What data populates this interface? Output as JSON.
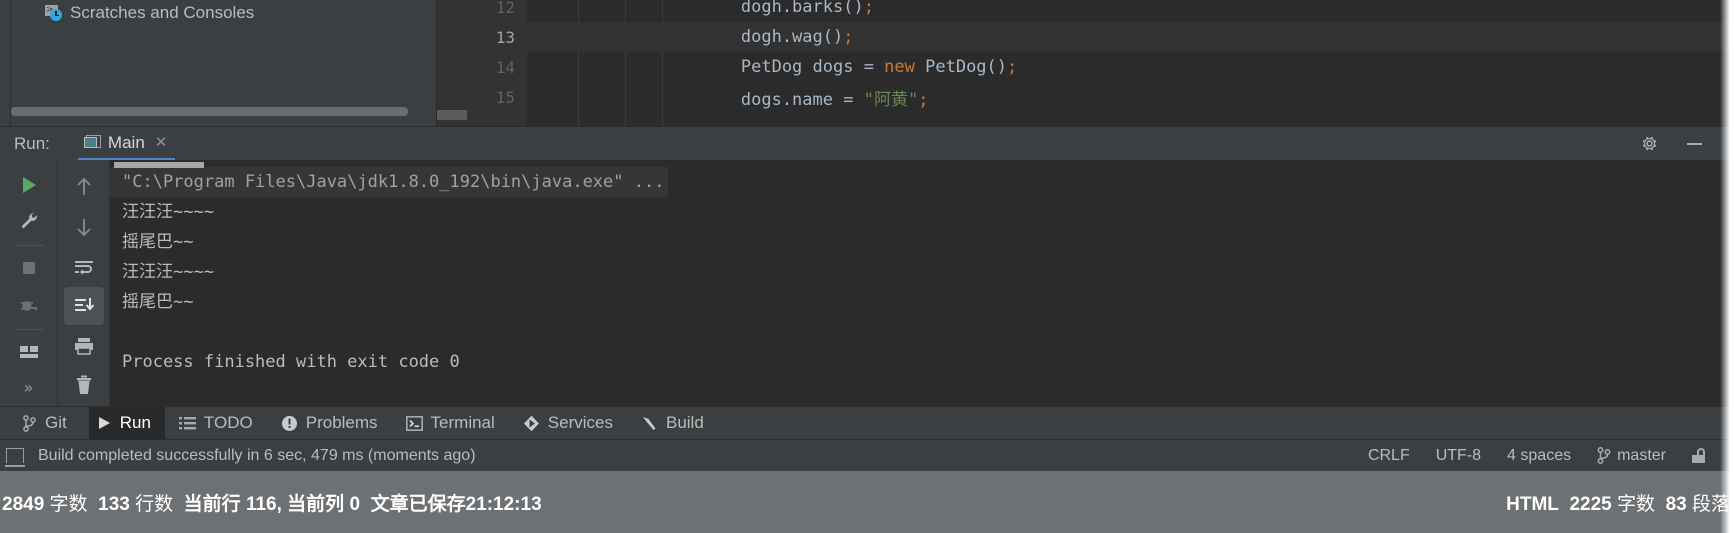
{
  "project_pane": {
    "tree_item": "Scratches and Consoles"
  },
  "editor": {
    "lines": [
      {
        "num": "12",
        "segments": [
          {
            "t": "        dogh.barks()",
            "c": "plain"
          },
          {
            "t": ";",
            "c": "punc"
          }
        ],
        "current": false
      },
      {
        "num": "13",
        "segments": [
          {
            "t": "        dogh.wag()",
            "c": "plain"
          },
          {
            "t": ";",
            "c": "punc"
          }
        ],
        "current": true
      },
      {
        "num": "14",
        "segments": [
          {
            "t": "        PetDog dogs = ",
            "c": "plain"
          },
          {
            "t": "new",
            "c": "kw"
          },
          {
            "t": " PetDog()",
            "c": "plain"
          },
          {
            "t": ";",
            "c": "punc"
          }
        ],
        "current": false
      },
      {
        "num": "15",
        "segments": [
          {
            "t": "        dogs.name = ",
            "c": "plain"
          },
          {
            "t": "\"阿黄\"",
            "c": "str"
          },
          {
            "t": ";",
            "c": "punc"
          }
        ],
        "current": false
      }
    ]
  },
  "run_panel": {
    "label": "Run:",
    "tab_name": "Main",
    "tab_close": "✕",
    "gear_icon": "gear-icon",
    "minimize_icon": "minimize-icon",
    "toolbar_left": [
      {
        "name": "rerun-button",
        "icon": "play-icon"
      },
      {
        "name": "edit-configurations-button",
        "icon": "wrench-icon"
      },
      {
        "name": "stop-button",
        "icon": "stop-square-icon"
      },
      {
        "name": "rerun-failed-tests-button",
        "icon": "bug-rerun-icon"
      },
      {
        "name": "layout-settings-button",
        "icon": "layout-icon"
      },
      {
        "name": "expand-toolbar-button",
        "icon": "double-chevron-right-icon",
        "glyph": "»"
      }
    ],
    "toolbar_right": [
      {
        "name": "up-the-stack-trace-button",
        "icon": "arrow-up-icon"
      },
      {
        "name": "down-the-stack-trace-button",
        "icon": "arrow-down-icon"
      },
      {
        "name": "soft-wrap-button",
        "icon": "soft-wrap-icon"
      },
      {
        "name": "scroll-to-end-button",
        "icon": "scroll-to-end-icon",
        "selected": true
      },
      {
        "name": "print-button",
        "icon": "printer-icon"
      },
      {
        "name": "clear-all-button",
        "icon": "trash-icon"
      }
    ],
    "console_lines": [
      {
        "text": "\"C:\\Program Files\\Java\\jdk1.8.0_192\\bin\\java.exe\" ...",
        "kind": "command"
      },
      {
        "text": "汪汪汪~~~~",
        "kind": "out"
      },
      {
        "text": "摇尾巴~~",
        "kind": "out"
      },
      {
        "text": "汪汪汪~~~~",
        "kind": "out"
      },
      {
        "text": "摇尾巴~~",
        "kind": "out"
      },
      {
        "text": "",
        "kind": "out"
      },
      {
        "text": "Process finished with exit code 0",
        "kind": "out"
      }
    ]
  },
  "bottom_tabs": [
    {
      "label": "Git",
      "icon": "git-branch-icon",
      "active": false
    },
    {
      "label": "Run",
      "icon": "play-icon",
      "active": true
    },
    {
      "label": "TODO",
      "icon": "list-icon",
      "active": false
    },
    {
      "label": "Problems",
      "icon": "exclamation-circle-icon",
      "active": false
    },
    {
      "label": "Terminal",
      "icon": "terminal-icon",
      "active": false
    },
    {
      "label": "Services",
      "icon": "services-icon",
      "active": false
    },
    {
      "label": "Build",
      "icon": "hammer-icon",
      "active": false
    }
  ],
  "status_bar": {
    "message": "Build completed successfully in 6 sec, 479 ms (moments ago)",
    "line_separator": "CRLF",
    "encoding": "UTF-8",
    "indent": "4 spaces",
    "branch": "master",
    "lock_icon": "lock-open-icon"
  },
  "doc_bar": {
    "left": [
      {
        "value": "2849",
        "label": " 字数"
      },
      {
        "value": "133",
        "label": " 行数"
      },
      {
        "value": "当前行 116, 当前列 0",
        "label": ""
      },
      {
        "value": "文章已保存21:12:13",
        "label": ""
      }
    ],
    "right": [
      {
        "value": "HTML",
        "label": ""
      },
      {
        "value": "2225",
        "label": " 字数"
      },
      {
        "value": "83",
        "label": " 段落"
      }
    ]
  },
  "colors": {
    "panel_bg": "#3c3f41",
    "editor_bg": "#2b2b2b",
    "accent_blue": "#4a88c7",
    "run_green": "#59a869",
    "doc_bar_bg": "#6e7173"
  }
}
